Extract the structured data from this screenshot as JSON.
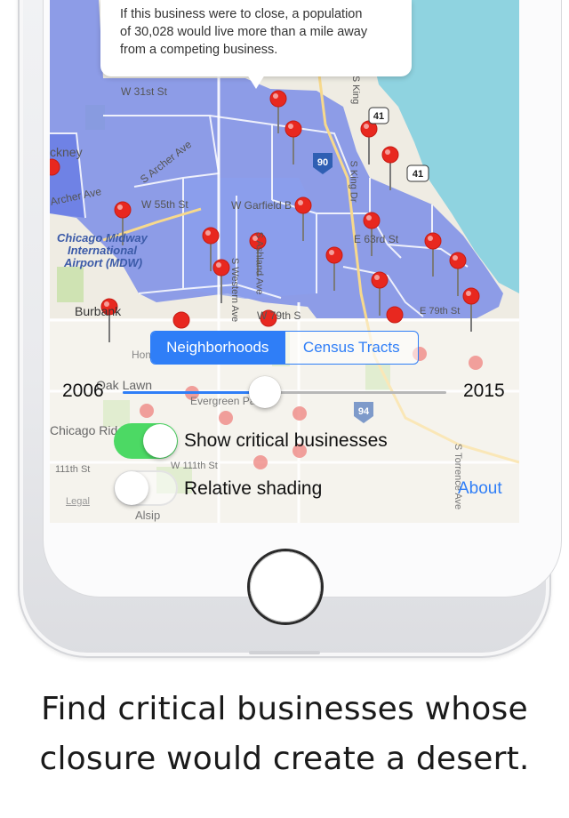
{
  "popup": {
    "line1": "If this business were to close, a population",
    "line2": "of 30,028 would live more than a mile away",
    "line3": "from a competing business."
  },
  "map": {
    "labels": {
      "w31st": "W 31st St",
      "ckney": "ckney",
      "archer_ave_left": "Archer Ave",
      "s_archer_ave": "S Archer Ave",
      "w55th": "W 55th St",
      "w_garfield": "W Garfield B",
      "midway_line1": "Chicago Midway",
      "midway_line2": "International",
      "midway_line3": "Airport (MDW)",
      "burbank": "Burbank",
      "s_western": "S Western Ave",
      "s_ashland": "S Ashland Ave",
      "w79th": "W 79th S",
      "s_king": "S King Dr",
      "s_king_top": "S King",
      "e63rd": "E 63rd St",
      "e79th": "E 79th St",
      "oak_lawn": "Oak Lawn",
      "evergreen_park": "Evergreen Park",
      "chicago_ridge": "Chicago Ridge",
      "w111th": "111th St",
      "w111th_b": "W 111th St",
      "s_torrence": "S Torrence Ave",
      "alsip": "Alsip",
      "legal": "Legal",
      "hometown": "Hometown",
      "highway_90": "90",
      "highway_41_a": "41",
      "highway_41_b": "41",
      "highway_94": "94"
    }
  },
  "controls": {
    "segment_neighborhoods": "Neighborhoods",
    "segment_census": "Census Tracts",
    "year_start": "2006",
    "year_end": "2015",
    "slider_fraction": 0.44,
    "show_critical_label": "Show critical businesses",
    "show_critical_on": true,
    "relative_shading_label": "Relative shading",
    "relative_shading_on": false,
    "about": "About"
  },
  "caption": {
    "line1": "Find critical businesses whose",
    "line2": "closure would create a desert."
  },
  "colors": {
    "accent": "#2f7ef7",
    "pin": "#e8281f",
    "toggle_on": "#4cd964",
    "region_fill": "#7b8ee8",
    "water": "#8fd3e0"
  }
}
